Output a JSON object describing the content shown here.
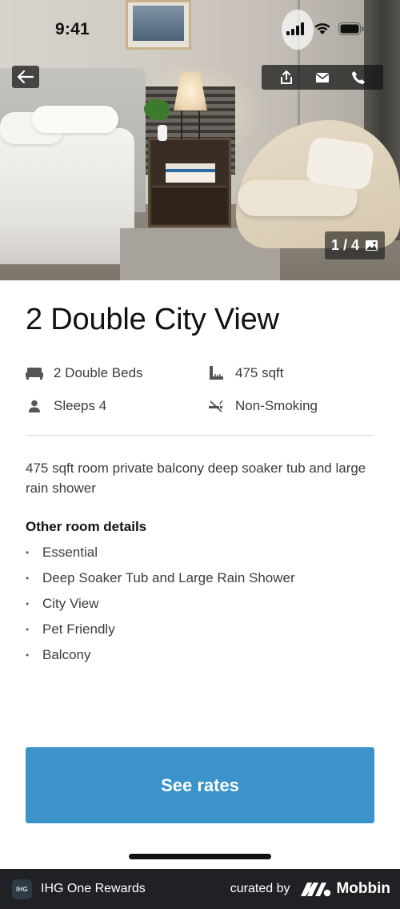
{
  "status_bar": {
    "time": "9:41"
  },
  "gallery": {
    "counter": "1 / 4"
  },
  "room": {
    "title": "2 Double City View",
    "amenities": {
      "beds": "2 Double Beds",
      "size": "475 sqft",
      "sleeps": "Sleeps 4",
      "smoking": "Non-Smoking"
    },
    "description": "475 sqft room private balcony deep soaker tub and large rain shower",
    "details_heading": "Other room details",
    "details": [
      "Essential",
      "Deep Soaker Tub and Large Rain Shower",
      "City View",
      "Pet Friendly",
      "Balcony"
    ]
  },
  "cta": {
    "label": "See rates"
  },
  "footer": {
    "app_logo_text": "IHG",
    "app_name": "IHG One Rewards",
    "curated_by": "curated by",
    "brand": "Mobbin"
  },
  "colors": {
    "primary_button": "#3b93c9",
    "footer_bg": "#202124"
  },
  "icons": [
    "back-arrow-icon",
    "share-icon",
    "mail-icon",
    "phone-icon",
    "gallery-icon",
    "bed-icon",
    "ruler-icon",
    "person-icon",
    "no-smoking-icon"
  ]
}
